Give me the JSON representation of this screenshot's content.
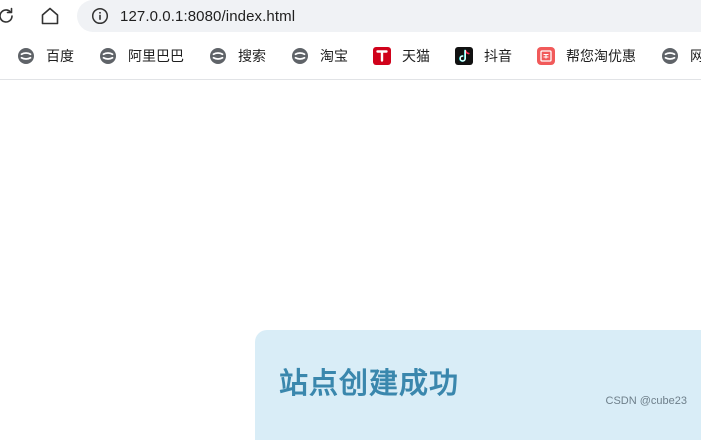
{
  "browser": {
    "url": "127.0.0.1:8080/index.html"
  },
  "bookmarks": [
    {
      "label": "百度",
      "icon": "globe-icon"
    },
    {
      "label": "阿里巴巴",
      "icon": "globe-icon"
    },
    {
      "label": "搜索",
      "icon": "globe-icon"
    },
    {
      "label": "淘宝",
      "icon": "globe-icon"
    },
    {
      "label": "天猫",
      "icon": "tmall-icon"
    },
    {
      "label": "抖音",
      "icon": "douyin-icon"
    },
    {
      "label": "帮您淘优惠",
      "icon": "coupon-icon"
    },
    {
      "label": "网址导",
      "icon": "globe-icon"
    }
  ],
  "page": {
    "title": "站点创建成功"
  },
  "watermark": "CSDN @cube23",
  "colors": {
    "panel_bg": "#d9edf7",
    "panel_title": "#3a87ad",
    "tmall": "#d0021b",
    "douyin": "#111111",
    "coupon": "#f15a5a"
  }
}
